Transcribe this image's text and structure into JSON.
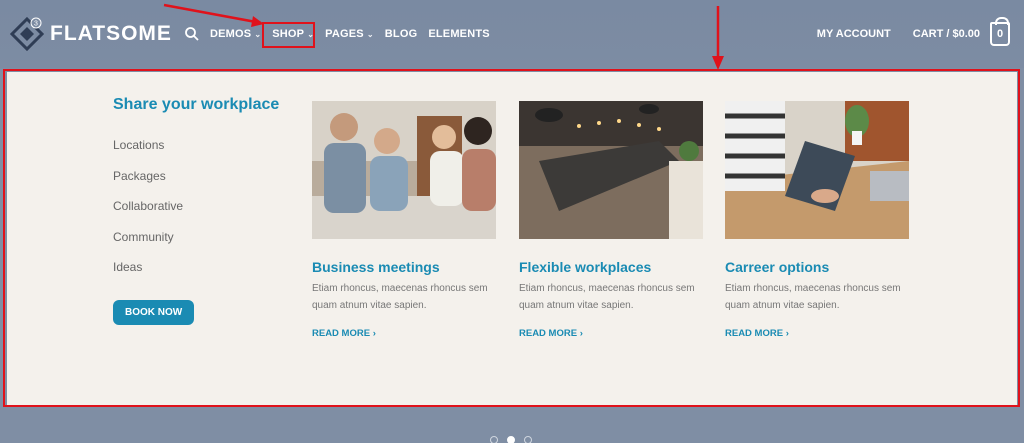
{
  "brand": {
    "name": "FLATSOME"
  },
  "nav": {
    "items": [
      {
        "label": "DEMOS",
        "has_dropdown": true
      },
      {
        "label": "SHOP",
        "has_dropdown": true
      },
      {
        "label": "PAGES",
        "has_dropdown": true
      },
      {
        "label": "BLOG",
        "has_dropdown": false
      },
      {
        "label": "ELEMENTS",
        "has_dropdown": false
      }
    ],
    "account": "MY ACCOUNT",
    "cart": "CART / $0.00",
    "cart_count": "0"
  },
  "mega": {
    "heading": "Share your workplace",
    "links": [
      "Locations",
      "Packages",
      "Collaborative",
      "Community",
      "Ideas"
    ],
    "cta": "BOOK NOW",
    "cards": [
      {
        "title": "Business meetings",
        "text": "Etiam rhoncus, maecenas rhoncus sem quam atnum vitae sapien.",
        "more": "READ MORE"
      },
      {
        "title": "Flexible workplaces",
        "text": "Etiam rhoncus, maecenas rhoncus sem quam atnum vitae sapien.",
        "more": "READ MORE"
      },
      {
        "title": "Carreer options",
        "text": "Etiam rhoncus, maecenas rhoncus sem quam atnum vitae sapien.",
        "more": "READ MORE"
      }
    ]
  },
  "colors": {
    "accent": "#1a8bb3",
    "header": "#7f8ea4",
    "annotation": "#e0121b",
    "panel": "#f4f1ec"
  },
  "slider": {
    "dots": 3,
    "active": 2
  }
}
